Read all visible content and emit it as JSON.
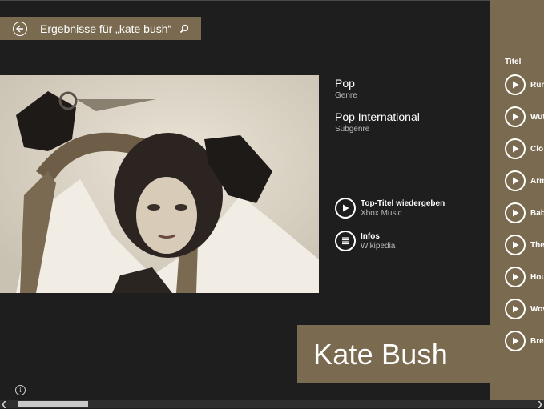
{
  "search": {
    "title": "Ergebnisse für „kate bush“",
    "back_icon": "back-arrow-icon",
    "search_icon": "search-icon"
  },
  "genre": {
    "main": "Pop",
    "main_label": "Genre",
    "sub": "Pop International",
    "sub_label": "Subgenre"
  },
  "actions": [
    {
      "title": "Top-Titel wiedergeben",
      "subtitle": "Xbox Music",
      "icon": "play-icon"
    },
    {
      "title": "Infos",
      "subtitle": "Wikipedia",
      "icon": "document-icon"
    }
  ],
  "artist": {
    "name": "Kate Bush"
  },
  "tracks_panel": {
    "heading": "Titel",
    "tracks": [
      "Run",
      "Wut",
      "Clo",
      "Arm",
      "Bab",
      "The",
      "Hou",
      "Wov",
      "Brea"
    ]
  },
  "colors": {
    "accent": "#7a6a4f",
    "background": "#1e1e1e",
    "secondary_text": "#b9b9b9"
  }
}
